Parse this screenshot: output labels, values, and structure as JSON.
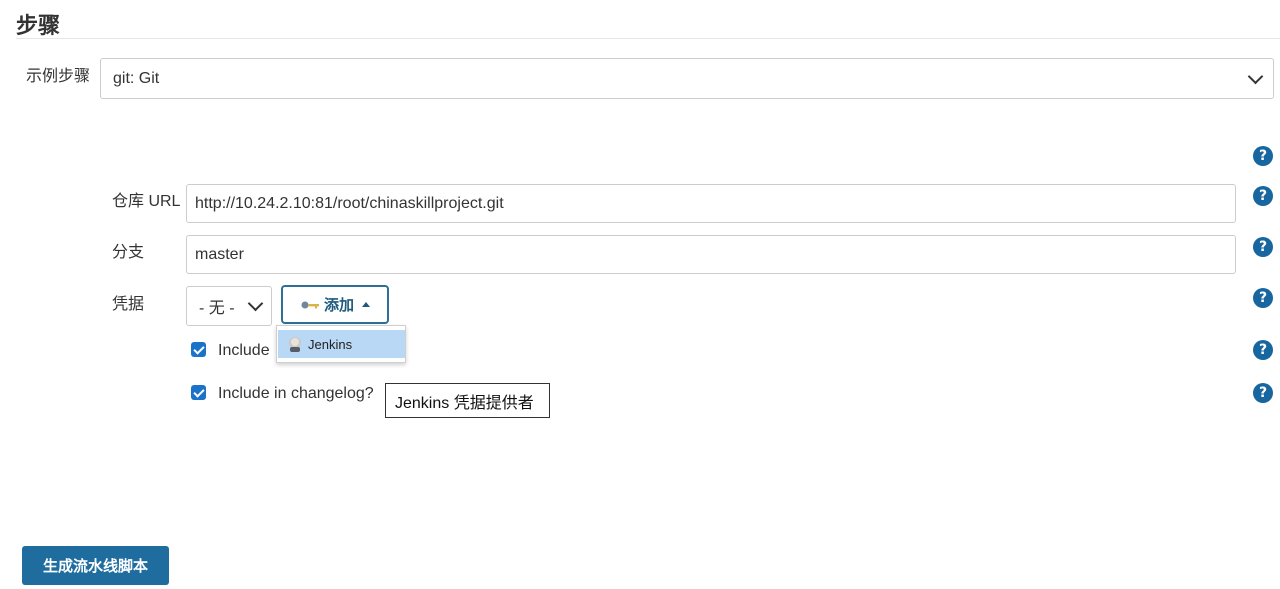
{
  "section": {
    "title": "步骤"
  },
  "sample_step": {
    "label": "示例步骤",
    "selected": "git: Git"
  },
  "repo_url": {
    "label": "仓库 URL",
    "value": "http://10.24.2.10:81/root/chinaskillproject.git"
  },
  "branch": {
    "label": "分支",
    "value": "master"
  },
  "credentials": {
    "label": "凭据",
    "selected": "- 无 -",
    "add_button": "添加",
    "dropdown_items": [
      {
        "label": "Jenkins"
      }
    ]
  },
  "checkboxes": [
    {
      "label": "Include",
      "checked": true
    },
    {
      "label": "Include in changelog?",
      "checked": true
    }
  ],
  "tooltip": {
    "text": "Jenkins 凭据提供者"
  },
  "generate_button": {
    "label": "生成流水线脚本"
  },
  "icons": {
    "help": "question-icon",
    "add": "key-icon",
    "jenkins": "jenkins-icon"
  },
  "colors": {
    "primary": "#1f6d9f",
    "help": "#1766a0",
    "checkbox": "#1a73c8",
    "dropdown_highlight": "#b9d8f5"
  }
}
